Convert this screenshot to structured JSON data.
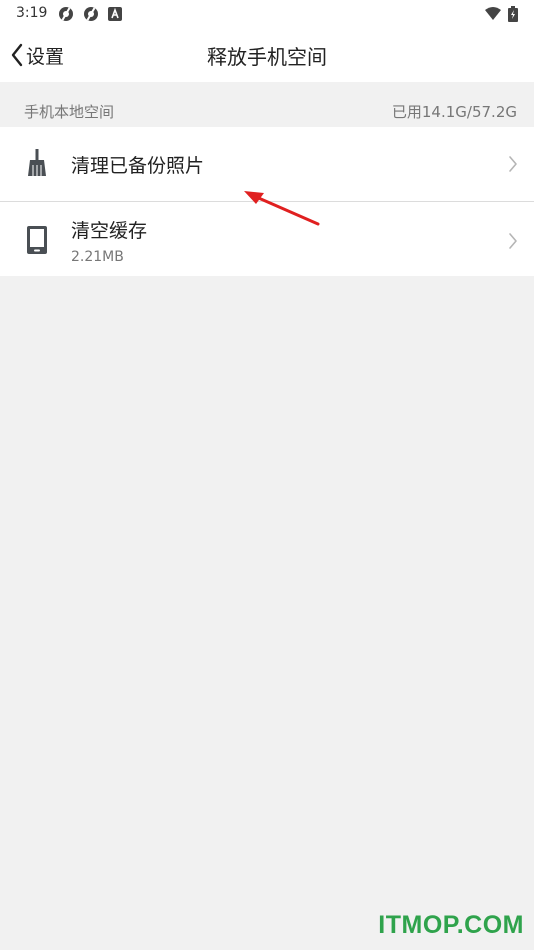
{
  "status_bar": {
    "time": "3:19",
    "icons": [
      "sync-icon",
      "sync-icon",
      "font-a-icon",
      "wifi-icon",
      "battery-icon"
    ]
  },
  "header": {
    "back_label": "设置",
    "title": "释放手机空间"
  },
  "storage": {
    "section_title": "手机本地空间",
    "usage": "已用14.1G/57.2G"
  },
  "items": [
    {
      "title": "清理已备份照片",
      "icon": "broom-icon"
    },
    {
      "title": "清空缓存",
      "subtitle": "2.21MB",
      "icon": "phone-icon"
    }
  ],
  "annotation": {
    "color": "#e02020",
    "icon": "red-arrow-icon"
  },
  "watermark": "ITMOP.COM",
  "colors": {
    "background": "#f1f1f1",
    "surface": "#ffffff",
    "secondary_text": "#777777",
    "watermark": "#2fa34c"
  }
}
